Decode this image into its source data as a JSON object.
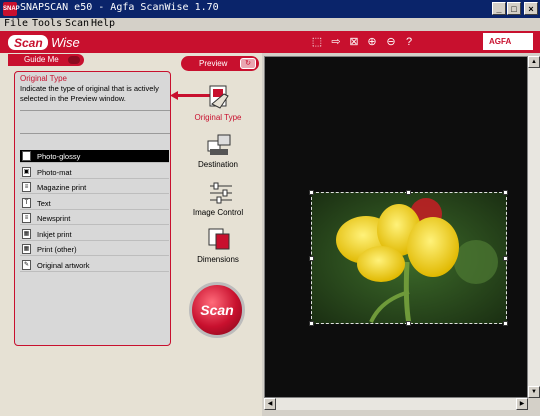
{
  "window": {
    "app_icon_label": "SNAP",
    "title": "SNAPSCAN e50 - Agfa ScanWise 1.70",
    "minimize": "_",
    "maximize": "□",
    "close": "×"
  },
  "menu": {
    "file": "File",
    "tools": "Tools",
    "scan": "Scan",
    "help": "Help"
  },
  "header": {
    "logo_scan": "Scan",
    "logo_wise": "Wise",
    "brand": "AGFA",
    "toolbar_icons": [
      "select-icon",
      "arrow-icon",
      "crop-icon",
      "zoom-in-icon",
      "zoom-out-icon",
      "help-icon"
    ]
  },
  "guide": {
    "label": "Guide Me"
  },
  "help_panel": {
    "title": "Original Type",
    "text": "Indicate the type of original that is actively selected in the Preview window."
  },
  "original_types": [
    {
      "label": "Photo-glossy",
      "selected": true
    },
    {
      "label": "Photo-mat",
      "selected": false
    },
    {
      "label": "Magazine print",
      "selected": false
    },
    {
      "label": "Text",
      "selected": false
    },
    {
      "label": "Newsprint",
      "selected": false
    },
    {
      "label": "Inkjet print",
      "selected": false
    },
    {
      "label": "Print (other)",
      "selected": false
    },
    {
      "label": "Original artwork",
      "selected": false
    }
  ],
  "preview_button": {
    "label": "Preview"
  },
  "steps": {
    "original_type": "Original Type",
    "destination": "Destination",
    "image_control": "Image Control",
    "dimensions": "Dimensions"
  },
  "scan_button": {
    "label": "Scan"
  },
  "colors": {
    "accent": "#c8102e",
    "panel": "#e6e1d4",
    "preview_bg": "#0d0d0d"
  }
}
